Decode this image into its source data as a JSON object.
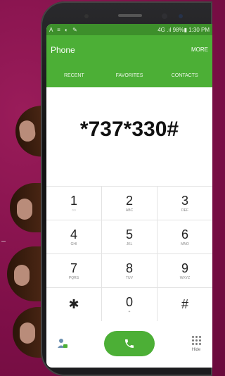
{
  "status": {
    "left_icons": "A ≡ ◐ ✎",
    "right": "98%▮ 1:30 PM",
    "signal": "4G .ıl"
  },
  "app": {
    "title": "Phone",
    "more": "MORE"
  },
  "tabs": [
    "RECENT",
    "FAVORITES",
    "CONTACTS"
  ],
  "dialed_number": "*737*330#",
  "keys": [
    [
      {
        "d": "1",
        "l": "○○"
      },
      {
        "d": "2",
        "l": "ABC"
      },
      {
        "d": "3",
        "l": "DEF"
      }
    ],
    [
      {
        "d": "4",
        "l": "GHI"
      },
      {
        "d": "5",
        "l": "JKL"
      },
      {
        "d": "6",
        "l": "MNO"
      }
    ],
    [
      {
        "d": "7",
        "l": "PQRS"
      },
      {
        "d": "8",
        "l": "TUV"
      },
      {
        "d": "9",
        "l": "WXYZ"
      }
    ],
    [
      {
        "d": "✱",
        "l": ""
      },
      {
        "d": "0",
        "l": "+"
      },
      {
        "d": "#",
        "l": ""
      }
    ]
  ],
  "bottom": {
    "hide_label": "Hide"
  },
  "colors": {
    "accent": "#4caf36",
    "status": "#3d8f2b",
    "background": "#7e0f48"
  }
}
